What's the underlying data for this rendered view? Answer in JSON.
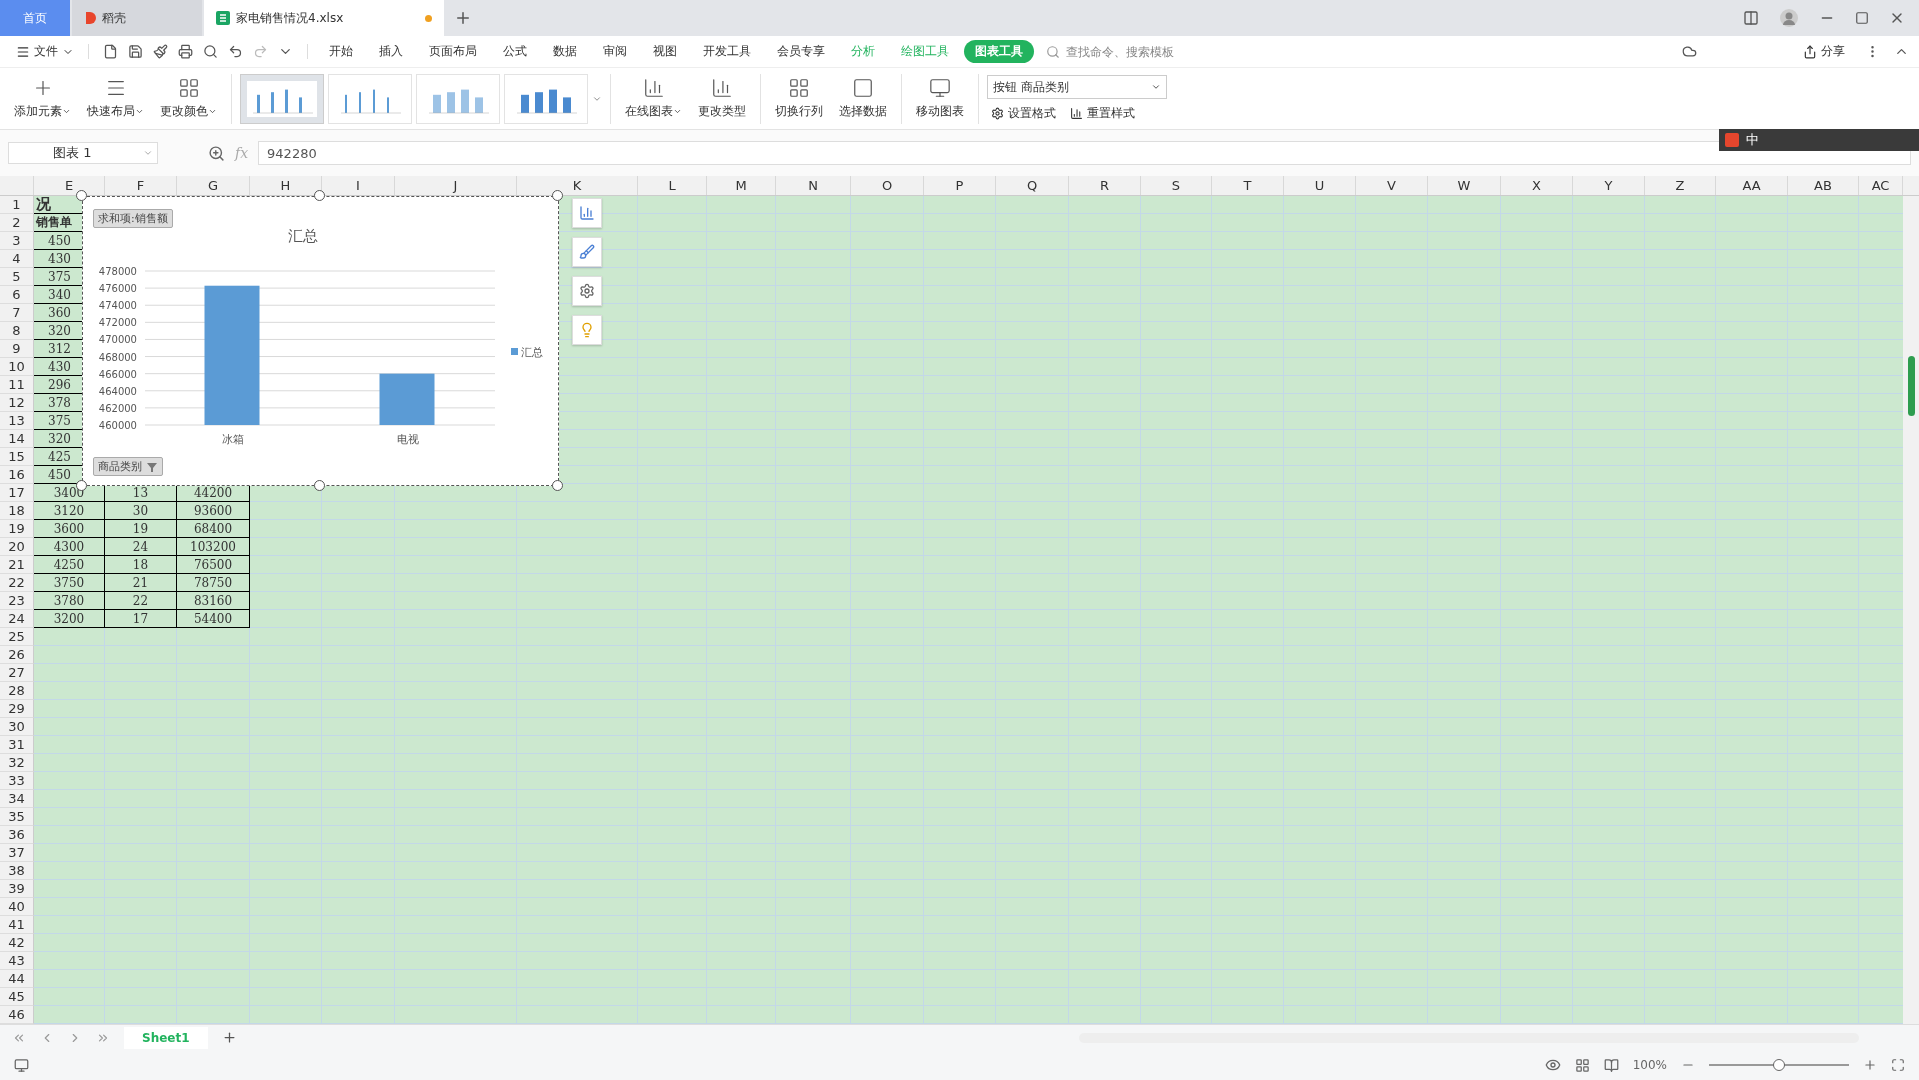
{
  "title_tabs": [
    {
      "kind": "home",
      "label": "首页",
      "selected": false
    },
    {
      "kind": "docer",
      "label": "稻壳",
      "selected": false
    },
    {
      "kind": "file",
      "label": "家电销售情况4.xlsx",
      "selected": true,
      "unsaved": true
    }
  ],
  "menu": {
    "file_label": "文件",
    "tabs": [
      {
        "label": "开始",
        "kind": "plain",
        "selected": false
      },
      {
        "label": "插入",
        "kind": "plain",
        "selected": false
      },
      {
        "label": "页面布局",
        "kind": "plain",
        "selected": false
      },
      {
        "label": "公式",
        "kind": "plain",
        "selected": false
      },
      {
        "label": "数据",
        "kind": "plain",
        "selected": false
      },
      {
        "label": "审阅",
        "kind": "plain",
        "selected": false
      },
      {
        "label": "视图",
        "kind": "plain",
        "selected": false
      },
      {
        "label": "开发工具",
        "kind": "plain",
        "selected": false
      },
      {
        "label": "会员专享",
        "kind": "plain",
        "selected": false
      },
      {
        "label": "分析",
        "kind": "context",
        "selected": false
      },
      {
        "label": "绘图工具",
        "kind": "context",
        "selected": false
      },
      {
        "label": "图表工具",
        "kind": "context",
        "selected": true
      }
    ],
    "search": {
      "placeholder": "查找命令、搜索模板"
    },
    "share": "分享"
  },
  "ribbon": {
    "tools_left": [
      {
        "label": "添加元素",
        "dropdown": true
      },
      {
        "label": "快速布局",
        "dropdown": true
      },
      {
        "label": "更改颜色",
        "dropdown": true
      }
    ],
    "styles": [
      {
        "selected": true,
        "kind": "thin"
      },
      {
        "selected": false,
        "kind": "line"
      },
      {
        "selected": false,
        "kind": "striped"
      },
      {
        "selected": false,
        "kind": "solid"
      }
    ],
    "tools_right": [
      {
        "label": "在线图表",
        "dropdown": true
      },
      {
        "label": "更改类型",
        "dropdown": false
      },
      {
        "label": "切换行列",
        "dropdown": false
      },
      {
        "label": "选择数据",
        "dropdown": false
      },
      {
        "label": "移动图表",
        "dropdown": false
      }
    ],
    "element_select": "按钮 商品类别",
    "format_button": "设置格式",
    "reset_button": "重置样式"
  },
  "ime_bar": {
    "mode": "中"
  },
  "formula_bar": {
    "name_box": "图表 1",
    "fx": "fx",
    "value": "942280"
  },
  "sheet": {
    "columns": [
      "E",
      "F",
      "G",
      "H",
      "I",
      "J",
      "K",
      "L",
      "M",
      "N",
      "O",
      "P",
      "Q",
      "R",
      "S",
      "T",
      "U",
      "V",
      "W",
      "X",
      "Y",
      "Z",
      "AA",
      "AB",
      "AC"
    ],
    "rows": [
      {
        "number": "1",
        "kind": "title",
        "cells": [
          "况"
        ]
      },
      {
        "number": "2",
        "kind": "heading",
        "cells": [
          "销售单"
        ]
      },
      {
        "number": "3",
        "kind": "hidden",
        "cells": [
          "450"
        ]
      },
      {
        "number": "4",
        "kind": "hidden",
        "cells": [
          "430"
        ]
      },
      {
        "number": "5",
        "kind": "hidden",
        "cells": [
          "375"
        ]
      },
      {
        "number": "6",
        "kind": "hidden",
        "cells": [
          "340"
        ]
      },
      {
        "number": "7",
        "kind": "hidden",
        "cells": [
          "360"
        ]
      },
      {
        "number": "8",
        "kind": "hidden",
        "cells": [
          "320"
        ]
      },
      {
        "number": "9",
        "kind": "hidden",
        "cells": [
          "312"
        ]
      },
      {
        "number": "10",
        "kind": "hidden",
        "cells": [
          "430"
        ]
      },
      {
        "number": "11",
        "kind": "hidden",
        "cells": [
          "296"
        ]
      },
      {
        "number": "12",
        "kind": "hidden",
        "cells": [
          "378"
        ]
      },
      {
        "number": "13",
        "kind": "hidden",
        "cells": [
          "375"
        ]
      },
      {
        "number": "14",
        "kind": "hidden",
        "cells": [
          "320"
        ]
      },
      {
        "number": "15",
        "kind": "hidden",
        "cells": [
          "425"
        ]
      },
      {
        "number": "16",
        "kind": "hidden",
        "cells": [
          "450"
        ]
      },
      {
        "number": "17",
        "kind": "data",
        "cells": [
          "3400",
          "13",
          "44200"
        ]
      },
      {
        "number": "18",
        "kind": "data",
        "cells": [
          "3120",
          "30",
          "93600"
        ]
      },
      {
        "number": "19",
        "kind": "data",
        "cells": [
          "3600",
          "19",
          "68400"
        ]
      },
      {
        "number": "20",
        "kind": "data",
        "cells": [
          "4300",
          "24",
          "103200"
        ]
      },
      {
        "number": "21",
        "kind": "data",
        "cells": [
          "4250",
          "18",
          "76500"
        ]
      },
      {
        "number": "22",
        "kind": "data",
        "cells": [
          "3750",
          "21",
          "78750"
        ]
      },
      {
        "number": "23",
        "kind": "data",
        "cells": [
          "3780",
          "22",
          "83160"
        ]
      },
      {
        "number": "24",
        "kind": "data",
        "cells": [
          "3200",
          "17",
          "54400"
        ]
      },
      {
        "number": "25"
      },
      {
        "number": "26"
      },
      {
        "number": "27"
      },
      {
        "number": "28"
      },
      {
        "number": "29"
      },
      {
        "number": "30"
      },
      {
        "number": "31"
      },
      {
        "number": "32"
      },
      {
        "number": "33"
      },
      {
        "number": "34"
      },
      {
        "number": "35"
      },
      {
        "number": "36"
      },
      {
        "number": "37"
      },
      {
        "number": "38"
      },
      {
        "number": "39"
      },
      {
        "number": "40"
      },
      {
        "number": "41"
      },
      {
        "number": "42"
      },
      {
        "number": "43"
      },
      {
        "number": "44"
      },
      {
        "number": "45"
      },
      {
        "number": "46"
      }
    ],
    "chart": {
      "value_field": "求和项:销售额",
      "axis_field": "商品类别",
      "chart_data": {
        "type": "bar",
        "grid": true,
        "title": "汇总",
        "categories": [
          "冰箱",
          "电视"
        ],
        "series": [
          {
            "name": "汇总",
            "color": "#5b9bd5",
            "values": [
              476280,
              466000
            ]
          }
        ],
        "ylim": [
          460000,
          478000
        ],
        "yticks": [
          {
            "value": 460000,
            "label": "460000"
          },
          {
            "value": 462000,
            "label": "462000"
          },
          {
            "value": 464000,
            "label": "464000"
          },
          {
            "value": 466000,
            "label": "466000"
          },
          {
            "value": 468000,
            "label": "468000"
          },
          {
            "value": 470000,
            "label": "470000"
          },
          {
            "value": 472000,
            "label": "472000"
          },
          {
            "value": 474000,
            "label": "474000"
          },
          {
            "value": 476000,
            "label": "476000"
          },
          {
            "value": 478000,
            "label": "478000"
          }
        ]
      }
    }
  },
  "sheet_tabs": [
    {
      "label": "Sheet1",
      "selected": true
    }
  ],
  "status": {
    "zoom": "100%",
    "zoom_slider": {
      "level": 0.5
    }
  }
}
